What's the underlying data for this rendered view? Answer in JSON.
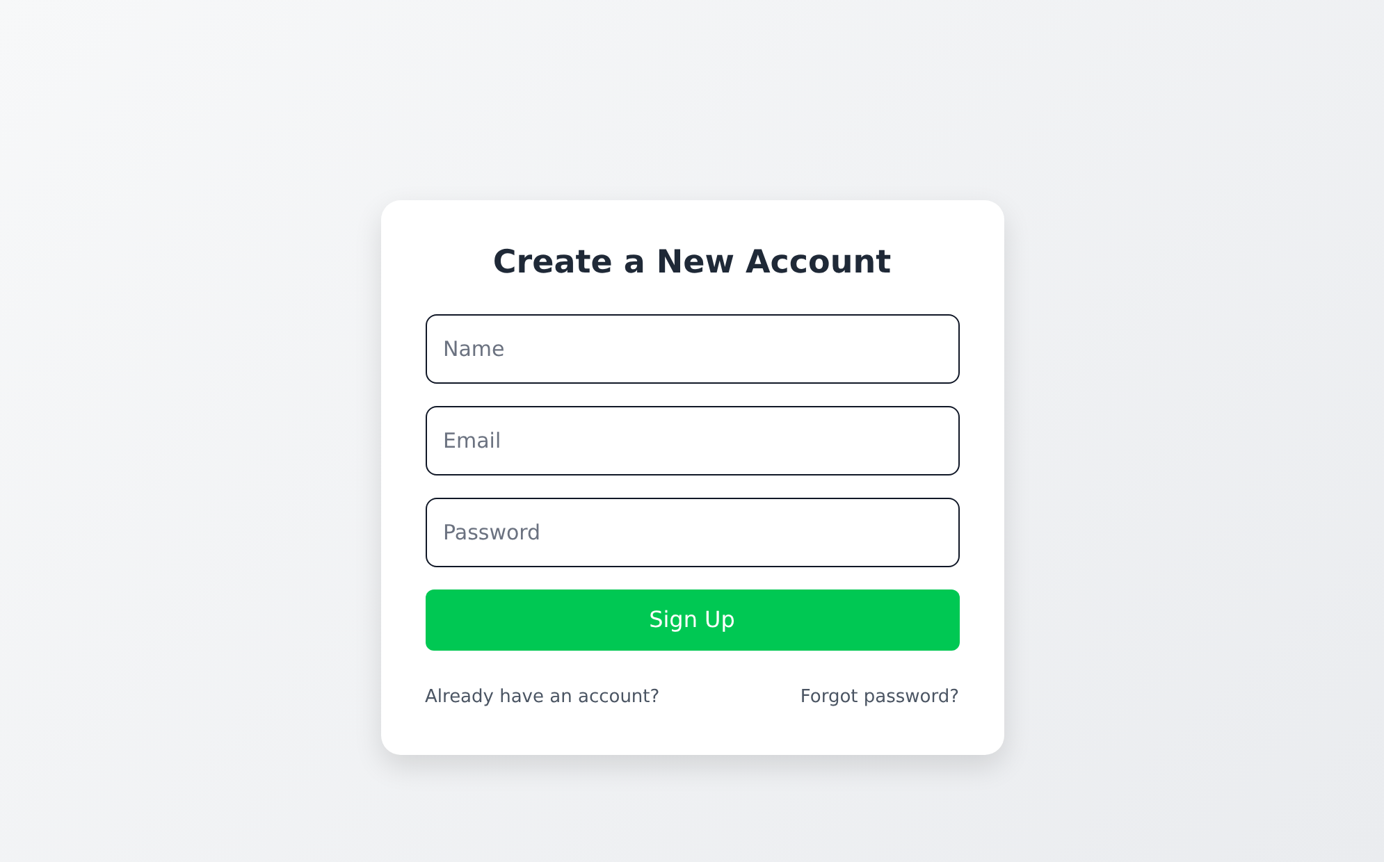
{
  "form": {
    "title": "Create a New Account",
    "fields": [
      {
        "placeholder": "Name"
      },
      {
        "placeholder": "Email"
      },
      {
        "placeholder": "Password"
      }
    ],
    "submit": "Sign Up",
    "links": [
      "Already have an account?",
      "Forgot password?"
    ]
  }
}
